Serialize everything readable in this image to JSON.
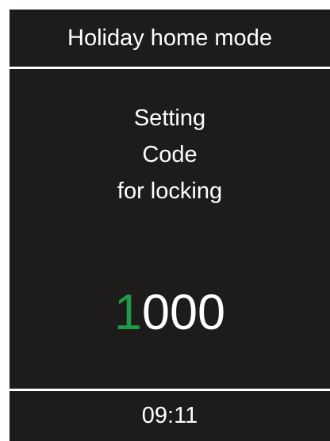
{
  "screen": {
    "title": "Holiday home mode",
    "message_lines": [
      "Setting",
      "Code",
      "for locking"
    ],
    "code": {
      "digits": [
        "1",
        "0",
        "0",
        "0"
      ],
      "active_digit_index": 0,
      "active_color": "#1f9a48"
    },
    "time": "09:11"
  },
  "colors": {
    "background": "#1e1b1b",
    "text": "#ffffff",
    "accent": "#1f9a48"
  }
}
